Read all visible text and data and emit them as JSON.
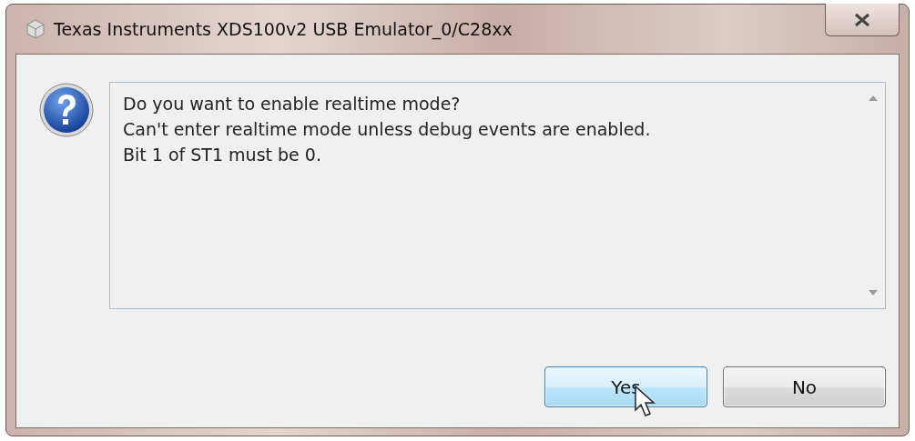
{
  "window": {
    "title": "Texas Instruments XDS100v2 USB Emulator_0/C28xx"
  },
  "message": {
    "lines": [
      "Do you want to enable realtime mode?",
      "Can't enter realtime mode unless debug events are enabled.",
      "Bit 1 of ST1 must be 0."
    ]
  },
  "buttons": [
    {
      "label": "Yes",
      "hovered": true
    },
    {
      "label": "No",
      "hovered": false
    }
  ]
}
